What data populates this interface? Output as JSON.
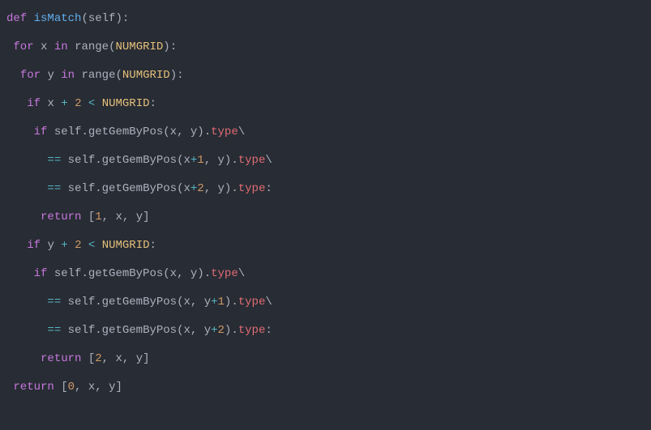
{
  "code": {
    "lines": [
      {
        "indent": "",
        "tokens": [
          {
            "cls": "kw",
            "t": "def"
          },
          {
            "cls": "punc",
            "t": " "
          },
          {
            "cls": "fn-def",
            "t": "isMatch"
          },
          {
            "cls": "punc",
            "t": "("
          },
          {
            "cls": "self",
            "t": "self"
          },
          {
            "cls": "punc",
            "t": "):"
          }
        ]
      },
      {
        "indent": " ",
        "tokens": [
          {
            "cls": "kw",
            "t": "for"
          },
          {
            "cls": "punc",
            "t": " "
          },
          {
            "cls": "var",
            "t": "x"
          },
          {
            "cls": "punc",
            "t": " "
          },
          {
            "cls": "kw",
            "t": "in"
          },
          {
            "cls": "punc",
            "t": " "
          },
          {
            "cls": "fn-call",
            "t": "range"
          },
          {
            "cls": "punc",
            "t": "("
          },
          {
            "cls": "const",
            "t": "NUMGRID"
          },
          {
            "cls": "punc",
            "t": "):"
          }
        ]
      },
      {
        "indent": "  ",
        "tokens": [
          {
            "cls": "kw",
            "t": "for"
          },
          {
            "cls": "punc",
            "t": " "
          },
          {
            "cls": "var",
            "t": "y"
          },
          {
            "cls": "punc",
            "t": " "
          },
          {
            "cls": "kw",
            "t": "in"
          },
          {
            "cls": "punc",
            "t": " "
          },
          {
            "cls": "fn-call",
            "t": "range"
          },
          {
            "cls": "punc",
            "t": "("
          },
          {
            "cls": "const",
            "t": "NUMGRID"
          },
          {
            "cls": "punc",
            "t": "):"
          }
        ]
      },
      {
        "indent": "   ",
        "tokens": [
          {
            "cls": "kw",
            "t": "if"
          },
          {
            "cls": "punc",
            "t": " "
          },
          {
            "cls": "var",
            "t": "x"
          },
          {
            "cls": "punc",
            "t": " "
          },
          {
            "cls": "op",
            "t": "+"
          },
          {
            "cls": "punc",
            "t": " "
          },
          {
            "cls": "num",
            "t": "2"
          },
          {
            "cls": "punc",
            "t": " "
          },
          {
            "cls": "op",
            "t": "<"
          },
          {
            "cls": "punc",
            "t": " "
          },
          {
            "cls": "const",
            "t": "NUMGRID"
          },
          {
            "cls": "punc",
            "t": ":"
          }
        ]
      },
      {
        "indent": "    ",
        "tokens": [
          {
            "cls": "kw",
            "t": "if"
          },
          {
            "cls": "punc",
            "t": " "
          },
          {
            "cls": "self",
            "t": "self"
          },
          {
            "cls": "punc",
            "t": "."
          },
          {
            "cls": "fn-call",
            "t": "getGemByPos"
          },
          {
            "cls": "punc",
            "t": "("
          },
          {
            "cls": "var",
            "t": "x"
          },
          {
            "cls": "punc",
            "t": ", "
          },
          {
            "cls": "var",
            "t": "y"
          },
          {
            "cls": "punc",
            "t": ")."
          },
          {
            "cls": "attr",
            "t": "type"
          },
          {
            "cls": "punc",
            "t": "\\"
          }
        ]
      },
      {
        "indent": "      ",
        "tokens": [
          {
            "cls": "op",
            "t": "=="
          },
          {
            "cls": "punc",
            "t": " "
          },
          {
            "cls": "self",
            "t": "self"
          },
          {
            "cls": "punc",
            "t": "."
          },
          {
            "cls": "fn-call",
            "t": "getGemByPos"
          },
          {
            "cls": "punc",
            "t": "("
          },
          {
            "cls": "var",
            "t": "x"
          },
          {
            "cls": "op",
            "t": "+"
          },
          {
            "cls": "num",
            "t": "1"
          },
          {
            "cls": "punc",
            "t": ", "
          },
          {
            "cls": "var",
            "t": "y"
          },
          {
            "cls": "punc",
            "t": ")."
          },
          {
            "cls": "attr",
            "t": "type"
          },
          {
            "cls": "punc",
            "t": "\\"
          }
        ]
      },
      {
        "indent": "      ",
        "tokens": [
          {
            "cls": "op",
            "t": "=="
          },
          {
            "cls": "punc",
            "t": " "
          },
          {
            "cls": "self",
            "t": "self"
          },
          {
            "cls": "punc",
            "t": "."
          },
          {
            "cls": "fn-call",
            "t": "getGemByPos"
          },
          {
            "cls": "punc",
            "t": "("
          },
          {
            "cls": "var",
            "t": "x"
          },
          {
            "cls": "op",
            "t": "+"
          },
          {
            "cls": "num",
            "t": "2"
          },
          {
            "cls": "punc",
            "t": ", "
          },
          {
            "cls": "var",
            "t": "y"
          },
          {
            "cls": "punc",
            "t": ")."
          },
          {
            "cls": "attr",
            "t": "type"
          },
          {
            "cls": "punc",
            "t": ":"
          }
        ]
      },
      {
        "indent": "     ",
        "tokens": [
          {
            "cls": "kw",
            "t": "return"
          },
          {
            "cls": "punc",
            "t": " ["
          },
          {
            "cls": "num",
            "t": "1"
          },
          {
            "cls": "punc",
            "t": ", "
          },
          {
            "cls": "var",
            "t": "x"
          },
          {
            "cls": "punc",
            "t": ", "
          },
          {
            "cls": "var",
            "t": "y"
          },
          {
            "cls": "punc",
            "t": "]"
          }
        ]
      },
      {
        "indent": "   ",
        "tokens": [
          {
            "cls": "kw",
            "t": "if"
          },
          {
            "cls": "punc",
            "t": " "
          },
          {
            "cls": "var",
            "t": "y"
          },
          {
            "cls": "punc",
            "t": " "
          },
          {
            "cls": "op",
            "t": "+"
          },
          {
            "cls": "punc",
            "t": " "
          },
          {
            "cls": "num",
            "t": "2"
          },
          {
            "cls": "punc",
            "t": " "
          },
          {
            "cls": "op",
            "t": "<"
          },
          {
            "cls": "punc",
            "t": " "
          },
          {
            "cls": "const",
            "t": "NUMGRID"
          },
          {
            "cls": "punc",
            "t": ":"
          }
        ]
      },
      {
        "indent": "    ",
        "tokens": [
          {
            "cls": "kw",
            "t": "if"
          },
          {
            "cls": "punc",
            "t": " "
          },
          {
            "cls": "self",
            "t": "self"
          },
          {
            "cls": "punc",
            "t": "."
          },
          {
            "cls": "fn-call",
            "t": "getGemByPos"
          },
          {
            "cls": "punc",
            "t": "("
          },
          {
            "cls": "var",
            "t": "x"
          },
          {
            "cls": "punc",
            "t": ", "
          },
          {
            "cls": "var",
            "t": "y"
          },
          {
            "cls": "punc",
            "t": ")."
          },
          {
            "cls": "attr",
            "t": "type"
          },
          {
            "cls": "punc",
            "t": "\\"
          }
        ]
      },
      {
        "indent": "      ",
        "tokens": [
          {
            "cls": "op",
            "t": "=="
          },
          {
            "cls": "punc",
            "t": " "
          },
          {
            "cls": "self",
            "t": "self"
          },
          {
            "cls": "punc",
            "t": "."
          },
          {
            "cls": "fn-call",
            "t": "getGemByPos"
          },
          {
            "cls": "punc",
            "t": "("
          },
          {
            "cls": "var",
            "t": "x"
          },
          {
            "cls": "punc",
            "t": ", "
          },
          {
            "cls": "var",
            "t": "y"
          },
          {
            "cls": "op",
            "t": "+"
          },
          {
            "cls": "num",
            "t": "1"
          },
          {
            "cls": "punc",
            "t": ")."
          },
          {
            "cls": "attr",
            "t": "type"
          },
          {
            "cls": "punc",
            "t": "\\"
          }
        ]
      },
      {
        "indent": "      ",
        "tokens": [
          {
            "cls": "op",
            "t": "=="
          },
          {
            "cls": "punc",
            "t": " "
          },
          {
            "cls": "self",
            "t": "self"
          },
          {
            "cls": "punc",
            "t": "."
          },
          {
            "cls": "fn-call",
            "t": "getGemByPos"
          },
          {
            "cls": "punc",
            "t": "("
          },
          {
            "cls": "var",
            "t": "x"
          },
          {
            "cls": "punc",
            "t": ", "
          },
          {
            "cls": "var",
            "t": "y"
          },
          {
            "cls": "op",
            "t": "+"
          },
          {
            "cls": "num",
            "t": "2"
          },
          {
            "cls": "punc",
            "t": ")."
          },
          {
            "cls": "attr",
            "t": "type"
          },
          {
            "cls": "punc",
            "t": ":"
          }
        ]
      },
      {
        "indent": "     ",
        "tokens": [
          {
            "cls": "kw",
            "t": "return"
          },
          {
            "cls": "punc",
            "t": " ["
          },
          {
            "cls": "num",
            "t": "2"
          },
          {
            "cls": "punc",
            "t": ", "
          },
          {
            "cls": "var",
            "t": "x"
          },
          {
            "cls": "punc",
            "t": ", "
          },
          {
            "cls": "var",
            "t": "y"
          },
          {
            "cls": "punc",
            "t": "]"
          }
        ]
      },
      {
        "indent": " ",
        "tokens": [
          {
            "cls": "kw",
            "t": "return"
          },
          {
            "cls": "punc",
            "t": " ["
          },
          {
            "cls": "num",
            "t": "0"
          },
          {
            "cls": "punc",
            "t": ", "
          },
          {
            "cls": "var",
            "t": "x"
          },
          {
            "cls": "punc",
            "t": ", "
          },
          {
            "cls": "var",
            "t": "y"
          },
          {
            "cls": "punc",
            "t": "]"
          }
        ]
      }
    ]
  }
}
